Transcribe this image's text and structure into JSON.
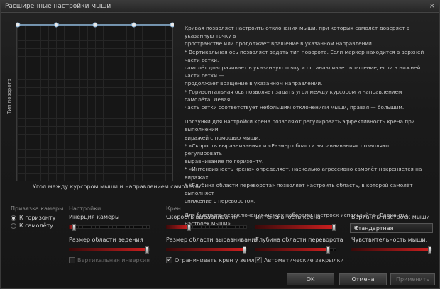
{
  "window": {
    "title": "Расширенные настройки мыши",
    "close": "×"
  },
  "curve": {
    "y_label": "Тип поворота",
    "x_label": "Угол между курсором мыши и направлением самолёта",
    "points": [
      0,
      0.25,
      0.5,
      0.75,
      1
    ],
    "line_color": "#8ab4d8"
  },
  "description": [
    "Кривая позволяет настроить отклонения мыши, при которых самолёт доверяет в указанную точку в",
    "пространстве или продолжает вращение в указанном направлении.",
    "* Вертикальная ось позволяет задать тип поворота. Если маркер находится в верхней части сетки,",
    "самолёт доворачивает в указанную точку и останавливает вращение, если в нижней части сетки —",
    "продолжает вращение в указанном направлении.",
    "* Горизонтальная ось позволяет задать угол между курсором и направлением самолёта. Левая",
    "часть сетки соответствует небольшим отклонениям мыши, правая — большим.",
    "",
    "Ползунки для настройки крена позволяют регулировать эффективность крена при выполнении",
    "виражей с помощью мыши.",
    "* «Скорость выравнивания» и «Размер области выравнивания» позволяют регулировать",
    "выравнивание по горизонту.",
    "* «Интенсивность крена» определяет, насколько агрессивно самолёт накреняется на виражах.",
    "* «Глубина области переворота» позволяет настроить область, в которой самолёт выполняет",
    "снижение с переворотом.",
    "",
    "Для быстрого переключения между наборами настроек используйте «Варианты настроек мыши»."
  ],
  "camera_binding": {
    "label": "Привязка камеры:",
    "options": [
      "К горизонту",
      "К самолёту"
    ],
    "selected": 0
  },
  "settings": {
    "label": "Настройки",
    "camera_inertia": {
      "label": "Инерция камеры",
      "value": 0.05
    },
    "guidance_area": {
      "label": "Размер области ведения",
      "value": 1.0
    },
    "vertical_invert": {
      "label": "Вертикальная инверсия",
      "checked": false
    }
  },
  "bank": {
    "label": "Крен",
    "leveling_speed": {
      "label": "Скорость выравнивания",
      "value": 0.28
    },
    "bank_intensity": {
      "label": "Интенсивность крена",
      "value": 1.0
    },
    "leveling_area": {
      "label": "Размер области выравнивания",
      "value": 1.0
    },
    "flip_depth": {
      "label": "Глубина области переворота",
      "value": 0.93
    },
    "limit_bank": {
      "label": "Ограничивать крен у земли",
      "checked": true
    },
    "auto_flaps": {
      "label": "Автоматические закрылки",
      "checked": true
    }
  },
  "presets": {
    "label": "Варианты настроек мыши",
    "selected": "Стандартная",
    "sensitivity": {
      "label": "Чувствительность мыши:",
      "value": 1.0
    }
  },
  "buttons": {
    "ok": "OK",
    "cancel": "Отмена",
    "apply": "Применить"
  }
}
